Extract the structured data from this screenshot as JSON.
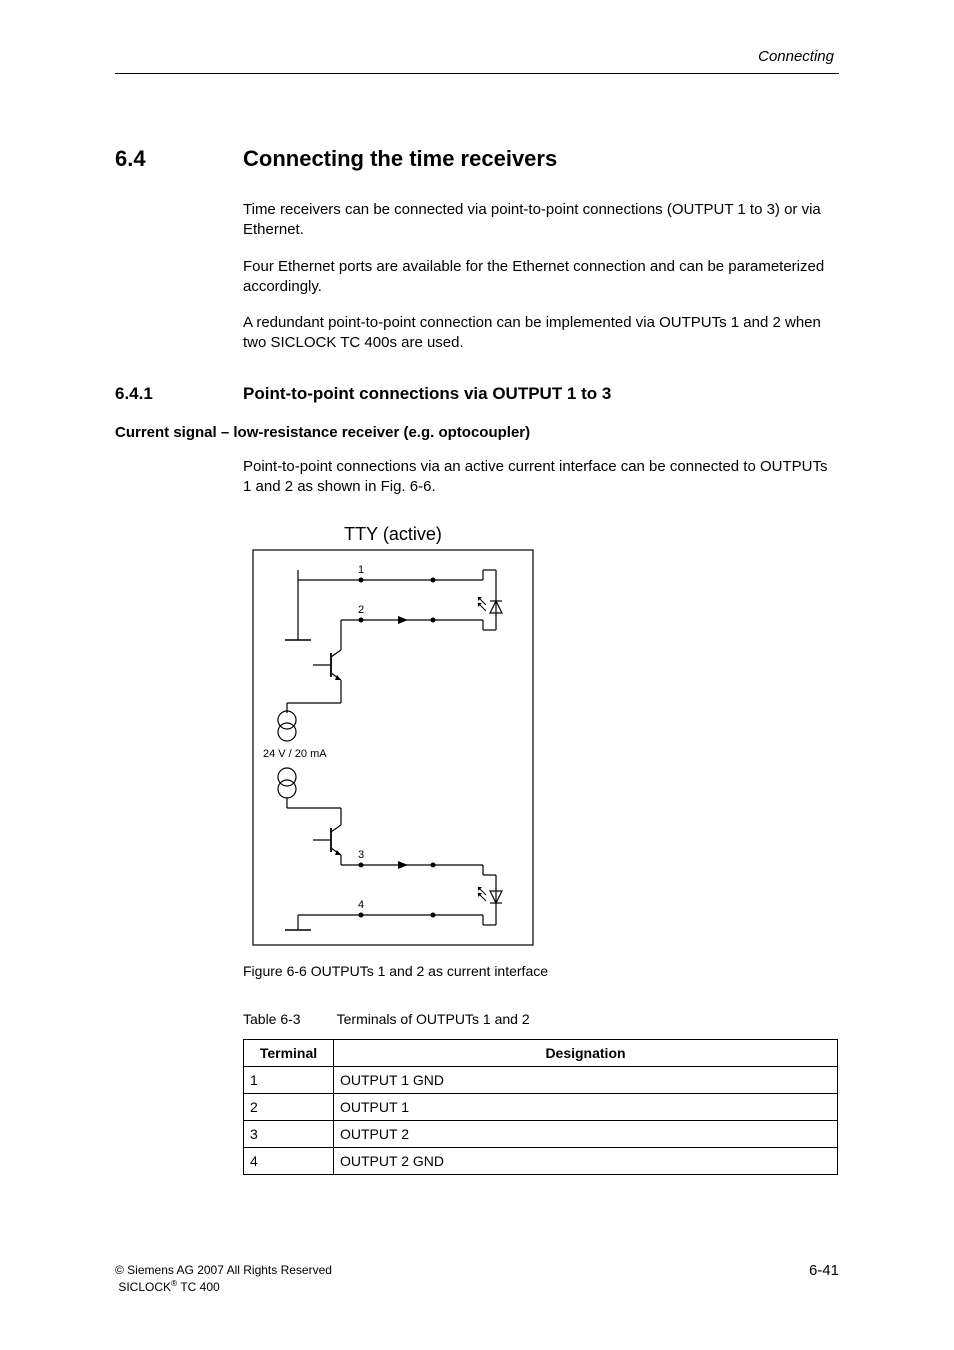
{
  "header": {
    "section_label": "Connecting"
  },
  "section": {
    "number": "6.4",
    "title": "Connecting the time receivers",
    "paragraphs": [
      "Time receivers can be connected via point-to-point connections (OUTPUT 1 to 3) or via Ethernet.",
      "Four Ethernet ports are available for the Ethernet connection and can be parameterized accordingly.",
      "A redundant point-to-point connection can be implemented via OUTPUTs 1 and 2 when two SICLOCK TC 400s are used."
    ]
  },
  "subsection": {
    "number": "6.4.1",
    "title": "Point-to-point connections via OUTPUT 1 to 3",
    "subheading": "Current signal – low-resistance receiver (e.g. optocoupler)",
    "paragraphs": [
      "Point-to-point connections via an active current interface can be connected to OUTPUTs 1 and 2 as shown in Fig. 6-6."
    ]
  },
  "diagram": {
    "title": "TTY (active)",
    "labels": {
      "pin1": "1",
      "pin2": "2",
      "pin3": "3",
      "pin4": "4",
      "power": "24 V / 20 mA"
    }
  },
  "figure_caption": "Figure 6-6 OUTPUTs 1 and 2 as current interface",
  "table": {
    "caption_num": "Table 6-3",
    "caption_text": "Terminals of OUTPUTs 1 and 2",
    "headers": {
      "terminal": "Terminal",
      "designation": "Designation"
    },
    "rows": [
      {
        "terminal": "1",
        "designation": "OUTPUT 1 GND"
      },
      {
        "terminal": "2",
        "designation": "OUTPUT 1"
      },
      {
        "terminal": "3",
        "designation": "OUTPUT 2"
      },
      {
        "terminal": "4",
        "designation": "OUTPUT 2 GND"
      }
    ]
  },
  "footer": {
    "copyright_prefix": "© Siemens AG 2007 All Rights Reserved",
    "product_line1": "SICLOCK",
    "product_sup": "®",
    "product_line2": " TC 400",
    "page": "6-41"
  }
}
